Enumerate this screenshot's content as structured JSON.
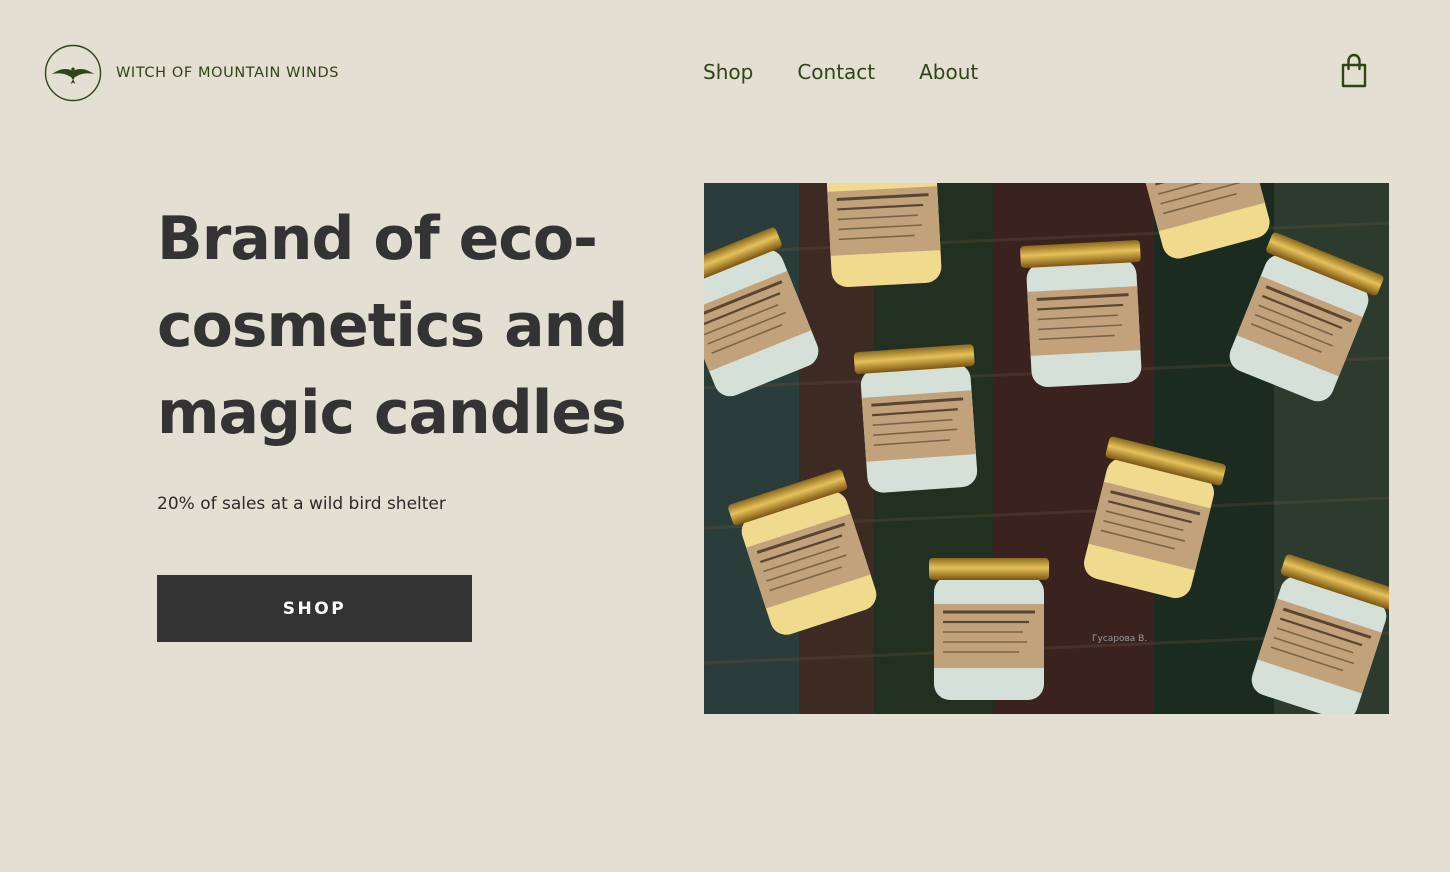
{
  "brand": {
    "name": "WITCH OF MOUNTAIN WINDS",
    "logo_icon": "bird-in-circle-icon",
    "color": "#2f4417"
  },
  "nav": {
    "items": [
      {
        "label": "Shop"
      },
      {
        "label": "Contact"
      },
      {
        "label": "About"
      }
    ]
  },
  "header": {
    "cart_icon": "shopping-bag-icon"
  },
  "hero": {
    "title": "Brand of eco-cosmetics and magic candles",
    "subtitle": "20% of sales at a wild bird shelter",
    "button_label": "SHOP",
    "image_icon": "product-jars-photo",
    "watermark": "Гусарова В."
  },
  "colors": {
    "background": "#e3dfd3",
    "text": "#333333",
    "accent": "#2f4417",
    "button": "#333333"
  }
}
